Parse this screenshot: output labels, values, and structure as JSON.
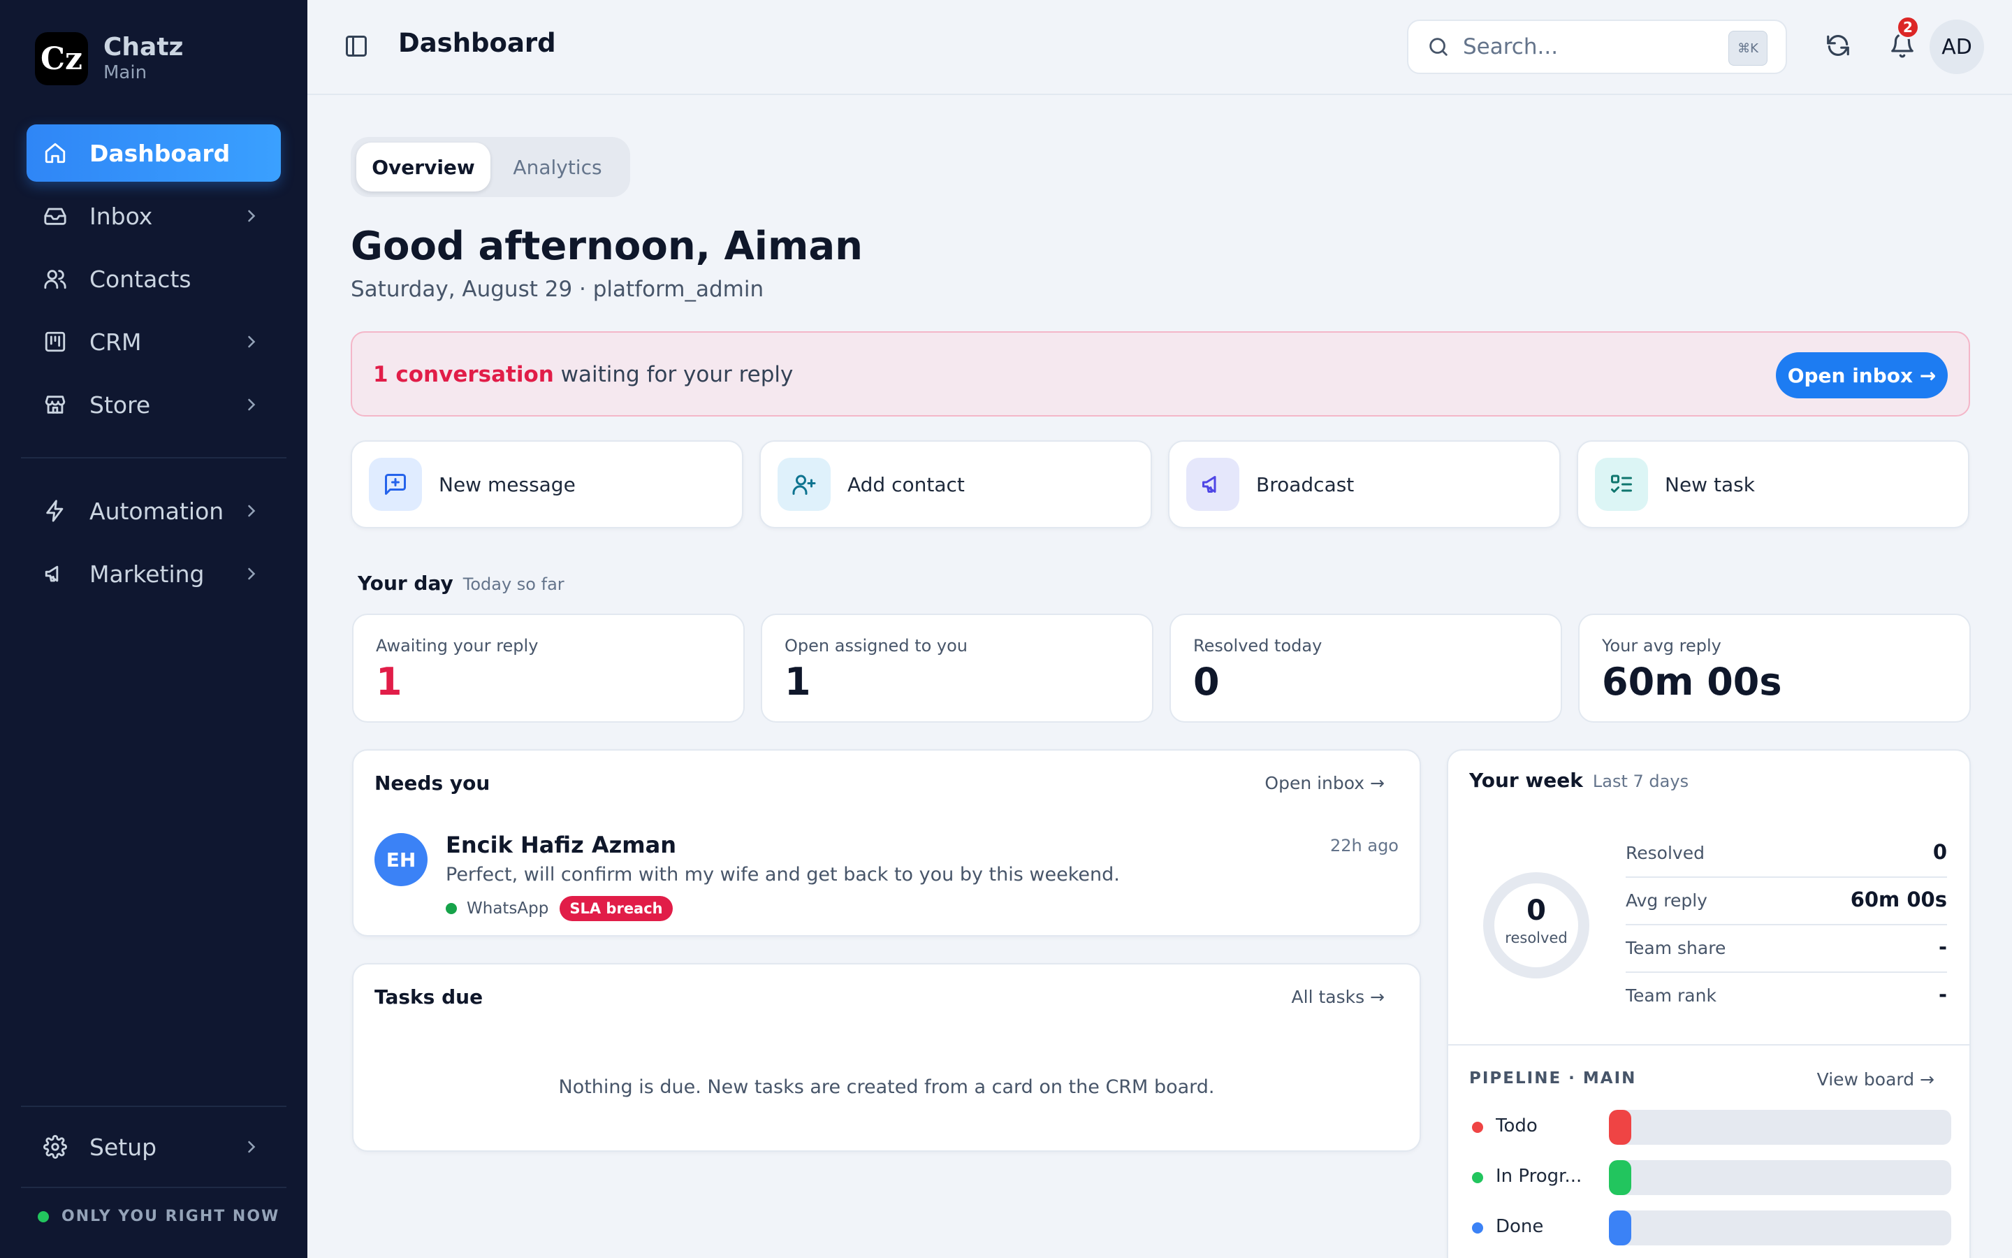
{
  "brand": {
    "name": "Chatz",
    "sub": "Main",
    "logo": "Cz"
  },
  "sidebar": {
    "items": [
      {
        "label": "Dashboard",
        "icon": "home-icon",
        "active": true
      },
      {
        "label": "Inbox",
        "icon": "inbox-icon"
      },
      {
        "label": "Contacts",
        "icon": "users-icon"
      },
      {
        "label": "CRM",
        "icon": "kanban-icon"
      },
      {
        "label": "Store",
        "icon": "store-icon"
      },
      {
        "label": "Automation",
        "icon": "bolt-icon"
      },
      {
        "label": "Marketing",
        "icon": "megaphone-icon"
      }
    ],
    "setup_label": "Setup",
    "presence": "ONLY YOU RIGHT NOW"
  },
  "topbar": {
    "title": "Dashboard",
    "search_placeholder": "Search...",
    "shortcut": "⌘K",
    "notifications": "2",
    "avatar": "AD"
  },
  "tabs": [
    {
      "label": "Overview"
    },
    {
      "label": "Analytics"
    }
  ],
  "greeting": "Good afternoon, Aiman",
  "subline": "Saturday, August 29 · platform_admin",
  "alert": {
    "highlight": "1 conversation",
    "rest": " waiting for your reply",
    "button": "Open inbox →"
  },
  "quick_actions": [
    {
      "label": "New message",
      "icon": "message-plus-icon",
      "bg": "#e0ecff",
      "color": "#2563eb"
    },
    {
      "label": "Add contact",
      "icon": "user-plus-icon",
      "bg": "#dff1fb",
      "color": "#0e7490"
    },
    {
      "label": "Broadcast",
      "icon": "megaphone-icon",
      "bg": "#e5e7fb",
      "color": "#4f46e5"
    },
    {
      "label": "New task",
      "icon": "checklist-icon",
      "bg": "#dcf5f5",
      "color": "#0f766e"
    }
  ],
  "your_day": {
    "title": "Your day",
    "subtitle": "Today so far",
    "stats": [
      {
        "label": "Awaiting your reply",
        "value": "1",
        "accent": "red"
      },
      {
        "label": "Open assigned to you",
        "value": "1"
      },
      {
        "label": "Resolved today",
        "value": "0"
      },
      {
        "label": "Your avg reply",
        "value": "60m 00s"
      }
    ]
  },
  "needs_you": {
    "title": "Needs you",
    "link": "Open inbox →",
    "conversation": {
      "initials": "EH",
      "name": "Encik Hafiz Azman",
      "time": "22h ago",
      "message": "Perfect, will confirm with my wife and get back to you by this weekend.",
      "channel": "WhatsApp",
      "badge": "SLA breach"
    }
  },
  "tasks_due": {
    "title": "Tasks due",
    "link": "All tasks →",
    "empty": "Nothing is due. New tasks are created from a card on the CRM board."
  },
  "your_week": {
    "title": "Your week",
    "subtitle": "Last 7 days",
    "ring_value": "0",
    "ring_label": "resolved",
    "rows": [
      {
        "label": "Resolved",
        "value": "0"
      },
      {
        "label": "Avg reply",
        "value": "60m 00s"
      },
      {
        "label": "Team share",
        "value": "-"
      },
      {
        "label": "Team rank",
        "value": "-"
      }
    ]
  },
  "pipeline": {
    "title": "PIPELINE · MAIN",
    "link": "View board →",
    "stages": [
      {
        "label": "Todo",
        "color": "#ef4444",
        "fraction": 0
      },
      {
        "label": "In Progr...",
        "color": "#22c55e",
        "fraction": 0
      },
      {
        "label": "Done",
        "color": "#3b82f6",
        "fraction": 0
      }
    ]
  }
}
